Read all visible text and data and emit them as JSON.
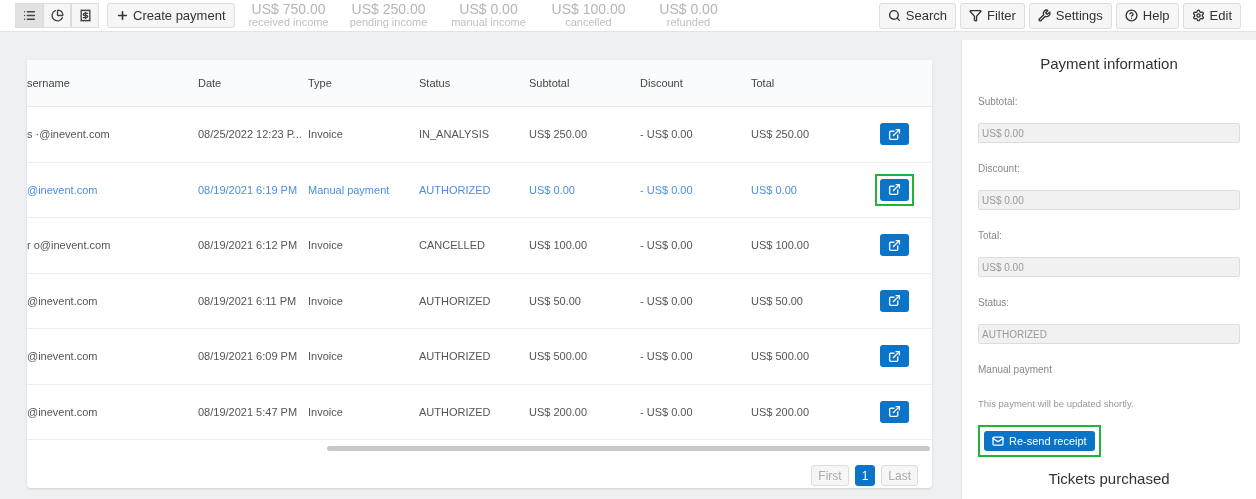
{
  "toolbar": {
    "views": [
      {
        "kind": "list",
        "selected": true
      },
      {
        "kind": "chart",
        "selected": false
      },
      {
        "kind": "receipt",
        "selected": false
      }
    ],
    "create_label": "Create payment",
    "stats": [
      {
        "value": "US$ 750.00",
        "label": "received income"
      },
      {
        "value": "US$ 250.00",
        "label": "pending income"
      },
      {
        "value": "US$ 0.00",
        "label": "manual income"
      },
      {
        "value": "US$ 100.00",
        "label": "cancelled"
      },
      {
        "value": "US$ 0.00",
        "label": "refunded"
      }
    ],
    "actions": [
      {
        "kind": "search",
        "label": "Search"
      },
      {
        "kind": "filter",
        "label": "Filter"
      },
      {
        "kind": "settings",
        "label": "Settings"
      },
      {
        "kind": "help",
        "label": "Help"
      },
      {
        "kind": "edit",
        "label": "Edit"
      }
    ]
  },
  "table": {
    "columns": [
      "sername",
      "Date",
      "Type",
      "Status",
      "Subtotal",
      "Discount",
      "Total"
    ],
    "rows": [
      {
        "selected": false,
        "highlighted": false,
        "cells": [
          "s  ·@inevent.com",
          "08/25/2022 12:23 P...",
          "Invoice",
          "IN_ANALYSIS",
          "US$ 250.00",
          "- US$ 0.00",
          "US$ 250.00"
        ]
      },
      {
        "selected": true,
        "highlighted": true,
        "cells": [
          "@inevent.com",
          "08/19/2021 6:19 PM",
          "Manual payment",
          "AUTHORIZED",
          "US$ 0.00",
          "- US$ 0.00",
          "US$ 0.00"
        ]
      },
      {
        "selected": false,
        "highlighted": false,
        "cells": [
          "r  o@inevent.com",
          "08/19/2021 6:12 PM",
          "Invoice",
          "CANCELLED",
          "US$ 100.00",
          "- US$ 0.00",
          "US$ 100.00"
        ]
      },
      {
        "selected": false,
        "highlighted": false,
        "cells": [
          "@inevent.com",
          "08/19/2021 6:11 PM",
          "Invoice",
          "AUTHORIZED",
          "US$ 50.00",
          "- US$ 0.00",
          "US$ 50.00"
        ]
      },
      {
        "selected": false,
        "highlighted": false,
        "cells": [
          "@inevent.com",
          "08/19/2021 6:09 PM",
          "Invoice",
          "AUTHORIZED",
          "US$ 500.00",
          "- US$ 0.00",
          "US$ 500.00"
        ]
      },
      {
        "selected": false,
        "highlighted": false,
        "cells": [
          "@inevent.com",
          "08/19/2021 5:47 PM",
          "Invoice",
          "AUTHORIZED",
          "US$ 200.00",
          "- US$ 0.00",
          "US$ 200.00"
        ]
      }
    ],
    "pagination": [
      {
        "label": "First",
        "selected": false
      },
      {
        "label": "1",
        "selected": true
      },
      {
        "label": "Last",
        "selected": false
      }
    ]
  },
  "panel": {
    "title": "Payment information",
    "fields": [
      {
        "label": "Subtotal:",
        "value": "US$ 0.00"
      },
      {
        "label": "Discount:",
        "value": "US$ 0.00"
      },
      {
        "label": "Total:",
        "value": "US$ 0.00"
      },
      {
        "label": "Status:",
        "value": "AUTHORIZED"
      }
    ],
    "type": "Manual payment",
    "note": "This payment will be updated shortly.",
    "resend": {
      "label": "Re-send receipt",
      "highlighted": true
    },
    "tickets_title": "Tickets purchased"
  }
}
